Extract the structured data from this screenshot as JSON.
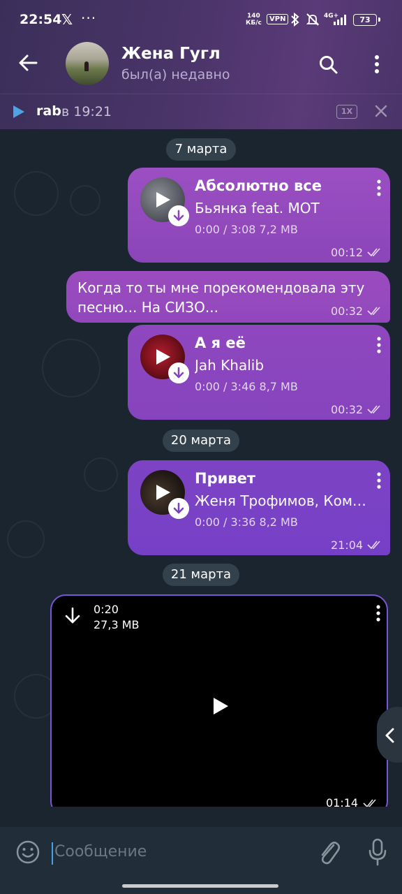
{
  "status": {
    "time": "22:54",
    "x_glyph": "𝕏",
    "dots": "···",
    "speed_value": "140",
    "speed_unit": "КБ/с",
    "vpn": "VPN",
    "network": "4G+",
    "battery": "73"
  },
  "header": {
    "title": "Жена Гугл",
    "subtitle": "был(а) недавно"
  },
  "player": {
    "name": "rab",
    "time": "в 19:21",
    "speed": "1X"
  },
  "messages": {
    "date1": "7 марта",
    "audio1": {
      "title": "Абсолютно все",
      "artist": "Бьянка feat. МОТ",
      "meta": "0:00 / 3:08  7,2 MB",
      "time": "00:12"
    },
    "text1": {
      "text": "Когда то ты мне порекомендовала эту песню... На СИЗО...",
      "time": "00:32"
    },
    "audio2": {
      "title": "А я её",
      "artist": "Jah Khalib",
      "meta": "0:00 / 3:46  8,7 MB",
      "time": "00:32"
    },
    "date2": "20 марта",
    "audio3": {
      "title": "Привет",
      "artist": "Женя Трофимов, Комн…",
      "meta": "0:00 / 3:36  8,2 MB",
      "time": "21:04"
    },
    "date3": "21 марта",
    "video": {
      "duration": "0:20",
      "size": "27,3 MB",
      "time": "01:14"
    }
  },
  "input": {
    "placeholder": "Сообщение"
  },
  "colors": {
    "bubble": "#9b4fc2",
    "header": "#4a3468",
    "background": "#1b2530",
    "video_border": "#7a55d8"
  }
}
